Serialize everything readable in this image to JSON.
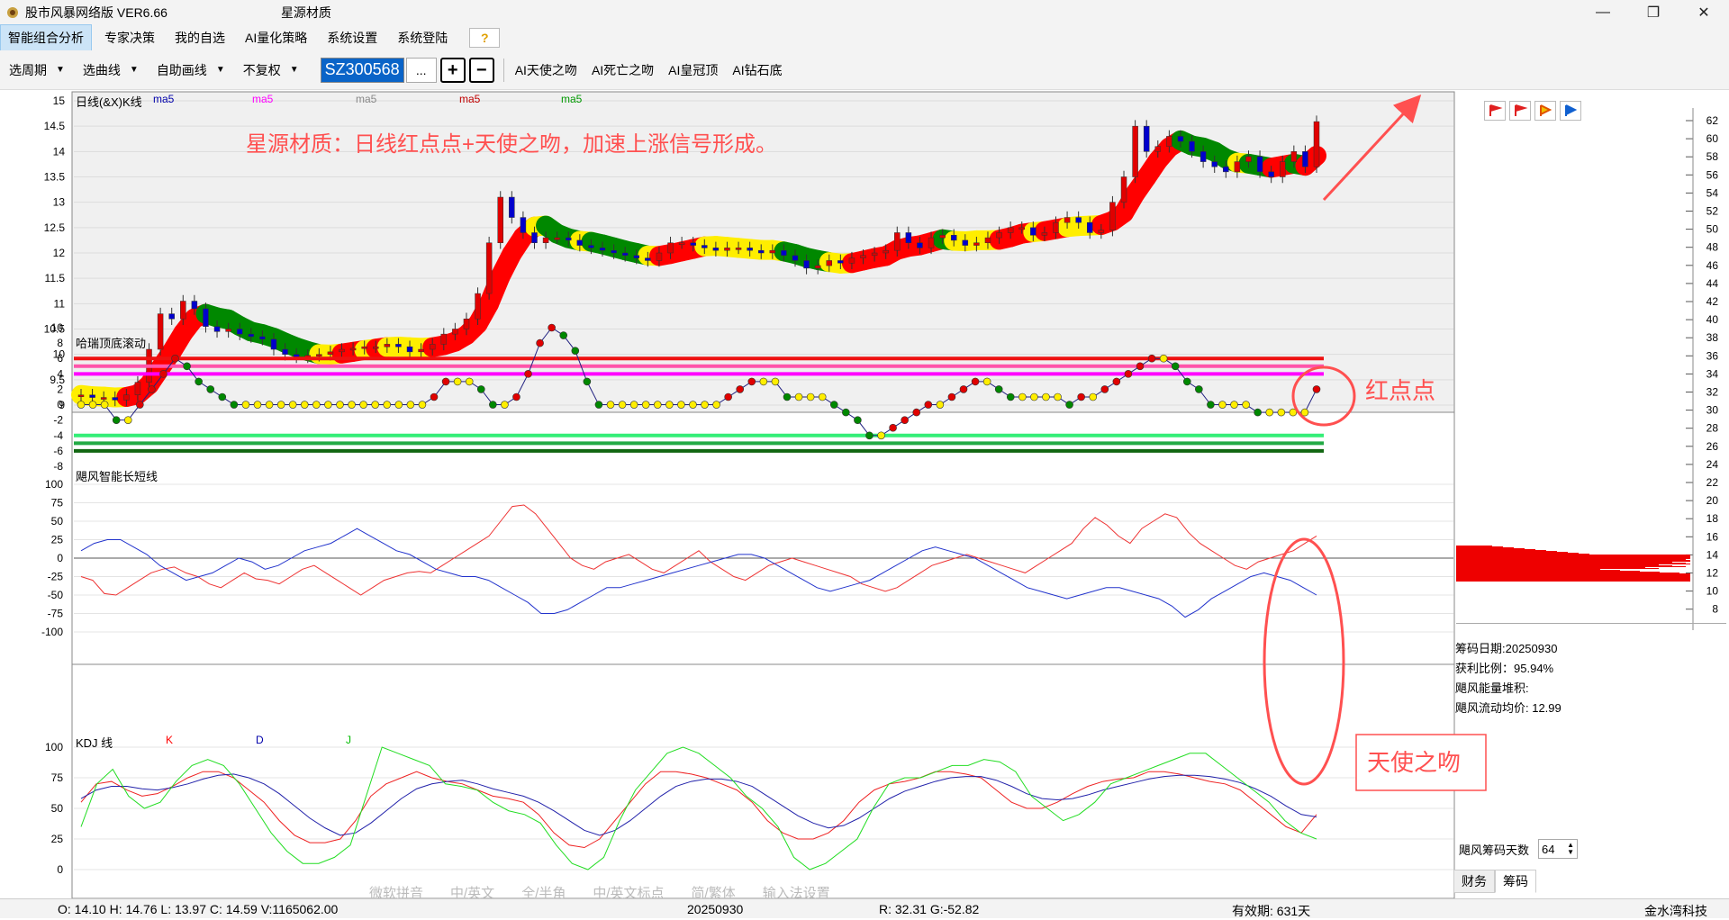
{
  "window": {
    "app_title": "股市风暴网络版 VER6.66",
    "stock_title": "星源材质"
  },
  "menu": [
    "智能组合分析",
    "专家决策",
    "我的自选",
    "AI量化策略",
    "系统设置",
    "系统登陆"
  ],
  "help_label": "?",
  "toolbar": {
    "period": "选周期",
    "curve": "选曲线",
    "draw": "自助画线",
    "adjust": "不复权",
    "code": "SZ300568",
    "dots": "...",
    "plus": "+",
    "minus": "−",
    "ai_buttons": [
      "AI天使之吻",
      "AI死亡之吻",
      "AI皇冠顶",
      "AI钻石底"
    ]
  },
  "panels": {
    "kline": {
      "title": "日线(&X)K线",
      "ma_labels": [
        "ma5",
        "ma5",
        "ma5",
        "ma5",
        "ma5"
      ],
      "ma_colors": [
        "#0000aa",
        "#ff00ff",
        "#888888",
        "#c00000",
        "#009900"
      ],
      "y_ticks": [
        "15",
        "14.5",
        "14",
        "13.5",
        "13",
        "12.5",
        "12",
        "11.5",
        "11",
        "10.5",
        "10",
        "9.5",
        "9"
      ],
      "annotation": "星源材质：日线红点点+天使之吻，加速上涨信号形成。"
    },
    "harry": {
      "title": "哈瑞顶底滚动",
      "y_ticks": [
        "10",
        "8",
        "6",
        "4",
        "2",
        "0",
        "-2",
        "-4",
        "-6",
        "-8"
      ],
      "annotation": "红点点"
    },
    "wind": {
      "title": "飓风智能长短线",
      "y_ticks": [
        "100",
        "75",
        "50",
        "25",
        "0",
        "-25",
        "-50",
        "-75",
        "-100"
      ]
    },
    "kdj": {
      "title": "KDJ 线",
      "labels": [
        "K",
        "D",
        "J"
      ],
      "label_colors": [
        "#ff0000",
        "#0000aa",
        "#00bb00"
      ],
      "y_ticks": [
        "100",
        "75",
        "50",
        "25",
        "0"
      ],
      "annotation": "天使之吻"
    }
  },
  "right_axis_ticks": [
    "62",
    "60",
    "58",
    "56",
    "54",
    "52",
    "50",
    "48",
    "46",
    "44",
    "42",
    "40",
    "38",
    "36",
    "34",
    "32",
    "30",
    "28",
    "26",
    "24",
    "22",
    "20",
    "18",
    "16",
    "14",
    "12",
    "10",
    "8"
  ],
  "chips": {
    "date": "筹码日期:20250930",
    "profit_label": "获利比例：",
    "profit_value": "95.94%",
    "energy": "飓风能量堆积:",
    "avg_price": "飓风流动均价: 12.99",
    "days_label": "飓风筹码天数",
    "days_value": "64"
  },
  "right_tabs": [
    "财务",
    "筹码"
  ],
  "ime_bar": [
    "微软拼音",
    "中/英文",
    "全/半角",
    "中/英文标点",
    "简/繁体",
    "输入法设置"
  ],
  "status": {
    "ohlc": "O: 14.10  H: 14.76  L: 13.97  C: 14.59  V:1165062.00",
    "date": "20250930",
    "rg": "R: 32.31  G:-52.82",
    "valid": "有效期:  631天",
    "company": "金水湾科技"
  },
  "chart_data": [
    {
      "type": "candlestick",
      "title": "日线(&X)K线",
      "ylim": [
        9,
        15
      ],
      "closes": [
        9.2,
        9.15,
        9.15,
        9.1,
        9.2,
        9.45,
        10.1,
        10.8,
        10.7,
        11.05,
        10.9,
        10.55,
        10.45,
        10.5,
        10.4,
        10.35,
        10.3,
        10.1,
        10.0,
        9.95,
        9.98,
        10.0,
        10.05,
        10.1,
        10.12,
        10.15,
        10.15,
        10.2,
        10.15,
        10.05,
        10.1,
        10.2,
        10.4,
        10.5,
        10.7,
        11.2,
        12.2,
        13.1,
        12.7,
        12.4,
        12.2,
        12.3,
        12.3,
        12.25,
        12.15,
        12.1,
        12.05,
        12.0,
        11.95,
        11.9,
        11.85,
        12.0,
        12.2,
        12.2,
        12.15,
        12.1,
        12.05,
        12.1,
        12.1,
        12.05,
        12.0,
        12.05,
        11.95,
        11.85,
        11.7,
        11.75,
        11.85,
        11.8,
        11.9,
        11.95,
        12.0,
        12.05,
        12.4,
        12.2,
        12.1,
        12.3,
        12.35,
        12.25,
        12.15,
        12.2,
        12.3,
        12.4,
        12.5,
        12.5,
        12.35,
        12.4,
        12.6,
        12.7,
        12.6,
        12.4,
        12.45,
        13.0,
        13.5,
        14.5,
        14.0,
        14.1,
        14.3,
        14.2,
        14.0,
        13.8,
        13.7,
        13.6,
        13.8,
        13.9,
        13.6,
        13.5,
        13.8,
        14.0,
        13.7,
        14.59
      ],
      "series_labels": [
        "ma5"
      ]
    },
    {
      "type": "line",
      "title": "哈瑞顶底滚动",
      "ylim": [
        -8,
        10
      ],
      "reference_lines": [
        6,
        5,
        4,
        -4,
        -5,
        -6
      ],
      "values": [
        0,
        0,
        0,
        -2,
        -2,
        0,
        2,
        4,
        6,
        5,
        3,
        2,
        1,
        0,
        0,
        0,
        0,
        0,
        0,
        0,
        0,
        0,
        0,
        0,
        0,
        0,
        0,
        0,
        0,
        0,
        1,
        3,
        3,
        3,
        2,
        0,
        0,
        1,
        4,
        8,
        10,
        9,
        7,
        3,
        0,
        0,
        0,
        0,
        0,
        0,
        0,
        0,
        0,
        0,
        0,
        1,
        2,
        3,
        3,
        3,
        1,
        1,
        1,
        1,
        0,
        -1,
        -2,
        -4,
        -4,
        -3,
        -2,
        -1,
        0,
        0,
        1,
        2,
        3,
        3,
        2,
        1,
        1,
        1,
        1,
        1,
        0,
        1,
        1,
        2,
        3,
        4,
        5,
        6,
        6,
        5,
        3,
        2,
        0,
        0,
        0,
        0,
        -1,
        -1,
        -1,
        -1,
        -1,
        2
      ]
    },
    {
      "type": "line",
      "title": "飓风智能长短线",
      "ylim": [
        -100,
        100
      ],
      "series": [
        {
          "name": "",
          "values": [
            -25,
            -30,
            -48,
            -50,
            -40,
            -30,
            -20,
            -15,
            -12,
            -20,
            -25,
            -35,
            -40,
            -30,
            -20,
            -28,
            -30,
            -35,
            -25,
            -15,
            -10,
            -20,
            -30,
            -40,
            -50,
            -40,
            -30,
            -25,
            -20,
            -18,
            -20,
            -10,
            0,
            10,
            20,
            30,
            50,
            70,
            72,
            60,
            40,
            20,
            0,
            -10,
            -15,
            -5,
            0,
            5,
            -5,
            -15,
            -20,
            -10,
            0,
            10,
            -5,
            -15,
            -25,
            -30,
            -20,
            -10,
            -5,
            0,
            -5,
            -10,
            -15,
            -20,
            -25,
            -35,
            -40,
            -45,
            -40,
            -30,
            -20,
            -10,
            -5,
            0,
            5,
            0,
            -5,
            -10,
            -15,
            -20,
            -10,
            0,
            10,
            20,
            40,
            55,
            45,
            30,
            20,
            40,
            50,
            60,
            55,
            35,
            20,
            10,
            0,
            -10,
            -15,
            -5,
            0,
            5,
            10,
            20,
            30
          ]
        },
        {
          "name": "",
          "values": [
            10,
            20,
            25,
            25,
            15,
            5,
            -10,
            -20,
            -30,
            -25,
            -20,
            -10,
            0,
            -5,
            -15,
            -10,
            0,
            10,
            15,
            20,
            30,
            40,
            30,
            20,
            10,
            5,
            -5,
            -15,
            -20,
            -25,
            -25,
            -30,
            -40,
            -50,
            -60,
            -75,
            -75,
            -70,
            -60,
            -50,
            -40,
            -40,
            -35,
            -30,
            -25,
            -20,
            -15,
            -10,
            -5,
            0,
            5,
            5,
            0,
            -10,
            -20,
            -30,
            -40,
            -45,
            -40,
            -35,
            -30,
            -20,
            -10,
            0,
            10,
            15,
            10,
            5,
            0,
            -10,
            -20,
            -30,
            -40,
            -45,
            -50,
            -55,
            -50,
            -45,
            -40,
            -40,
            -45,
            -50,
            -55,
            -65,
            -80,
            -70,
            -55,
            -45,
            -35,
            -25,
            -20,
            -25,
            -30,
            -40,
            -50
          ]
        }
      ]
    },
    {
      "type": "line",
      "title": "KDJ 线",
      "ylim": [
        0,
        100
      ],
      "series": [
        {
          "name": "K",
          "values": [
            55,
            70,
            72,
            65,
            60,
            62,
            68,
            75,
            80,
            80,
            75,
            65,
            55,
            40,
            28,
            22,
            22,
            25,
            40,
            60,
            70,
            75,
            80,
            75,
            72,
            70,
            65,
            60,
            58,
            55,
            45,
            30,
            20,
            18,
            25,
            40,
            55,
            70,
            80,
            80,
            78,
            75,
            70,
            65,
            55,
            40,
            30,
            25,
            25,
            30,
            40,
            55,
            65,
            70,
            72,
            75,
            80,
            80,
            78,
            75,
            65,
            55,
            50,
            50,
            55,
            62,
            68,
            72,
            74,
            75,
            80,
            80,
            78,
            75,
            72,
            70,
            65,
            55,
            45,
            35,
            30,
            45
          ]
        },
        {
          "name": "D",
          "values": [
            58,
            65,
            68,
            68,
            66,
            65,
            67,
            70,
            74,
            77,
            78,
            75,
            70,
            62,
            52,
            42,
            34,
            28,
            30,
            38,
            48,
            58,
            66,
            70,
            72,
            73,
            70,
            66,
            63,
            60,
            55,
            48,
            40,
            32,
            28,
            32,
            40,
            50,
            60,
            68,
            72,
            74,
            74,
            72,
            68,
            60,
            52,
            44,
            38,
            34,
            36,
            42,
            50,
            58,
            64,
            68,
            72,
            75,
            76,
            76,
            73,
            68,
            62,
            58,
            57,
            58,
            61,
            65,
            68,
            71,
            74,
            76,
            77,
            77,
            76,
            74,
            71,
            66,
            60,
            52,
            45,
            43
          ]
        },
        {
          "name": "J",
          "values": [
            35,
            70,
            82,
            60,
            50,
            55,
            72,
            85,
            90,
            85,
            70,
            50,
            30,
            15,
            5,
            5,
            10,
            20,
            60,
            100,
            95,
            90,
            85,
            70,
            68,
            65,
            55,
            48,
            45,
            38,
            20,
            5,
            0,
            10,
            40,
            65,
            80,
            95,
            100,
            95,
            85,
            75,
            60,
            50,
            35,
            10,
            0,
            5,
            15,
            25,
            50,
            70,
            75,
            75,
            80,
            85,
            85,
            90,
            88,
            80,
            60,
            50,
            40,
            45,
            55,
            70,
            75,
            80,
            85,
            90,
            95,
            95,
            85,
            75,
            65,
            55,
            40,
            30,
            25
          ]
        }
      ]
    }
  ]
}
